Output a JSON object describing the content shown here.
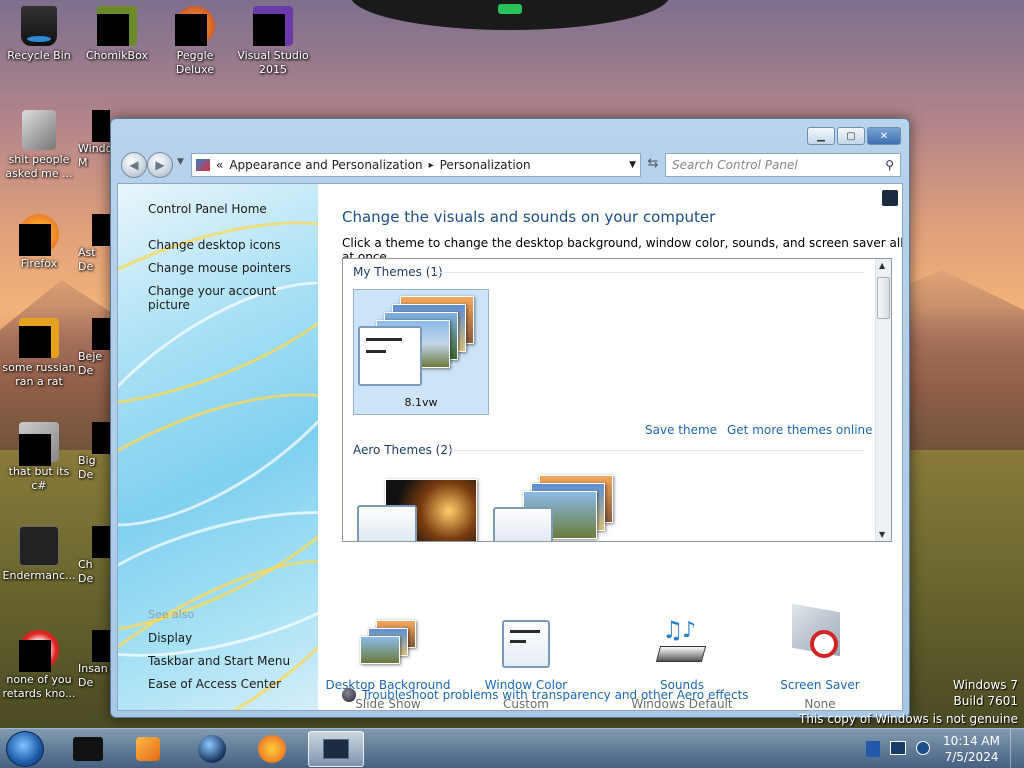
{
  "desktop": {
    "icons": [
      {
        "label": "Recycle Bin"
      },
      {
        "label": "ChomikBox"
      },
      {
        "label": "Peggle Deluxe"
      },
      {
        "label": "Visual Studio 2015"
      },
      {
        "label": "shit people asked me ..."
      },
      {
        "label": "Firefox"
      },
      {
        "label": "some russian ran a rat"
      },
      {
        "label": "that but its c#"
      },
      {
        "label": "Endermanc..."
      },
      {
        "label": "none of you retards kno..."
      }
    ],
    "partial_icons": [
      {
        "label": "Windo M"
      },
      {
        "label": "Ast De"
      },
      {
        "label": "Beje De"
      },
      {
        "label": "Big De"
      },
      {
        "label": "Ch De"
      },
      {
        "label": "Insan De"
      }
    ]
  },
  "window": {
    "breadcrumb": {
      "sep": "«",
      "item1": "Appearance and Personalization",
      "arrow": "▸",
      "item2": "Personalization"
    },
    "search_placeholder": "Search Control Panel",
    "sidebar": {
      "home": "Control Panel Home",
      "links": [
        "Change desktop icons",
        "Change mouse pointers",
        "Change your account picture"
      ],
      "see_also": "See also",
      "see_also_links": [
        "Display",
        "Taskbar and Start Menu",
        "Ease of Access Center"
      ]
    },
    "heading": "Change the visuals and sounds on your computer",
    "subtext": "Click a theme to change the desktop background, window color, sounds, and screen saver all at once.",
    "my_themes": "My Themes (1)",
    "theme_name": "8.1vw",
    "save_theme": "Save theme",
    "get_more": "Get more themes online",
    "aero_themes": "Aero Themes (2)",
    "props": [
      {
        "title": "Desktop Background",
        "sub": "Slide Show"
      },
      {
        "title": "Window Color",
        "sub": "Custom"
      },
      {
        "title": "Sounds",
        "sub": "Windows Default"
      },
      {
        "title": "Screen Saver",
        "sub": "None"
      }
    ],
    "troubleshoot": "Troubleshoot problems with transparency and other Aero effects"
  },
  "watermark": {
    "line1": "Windows 7",
    "line2": "Build 7601",
    "line3": "This copy of Windows is not genuine"
  },
  "taskbar": {
    "time": "10:14 AM",
    "date": "7/5/2024"
  }
}
